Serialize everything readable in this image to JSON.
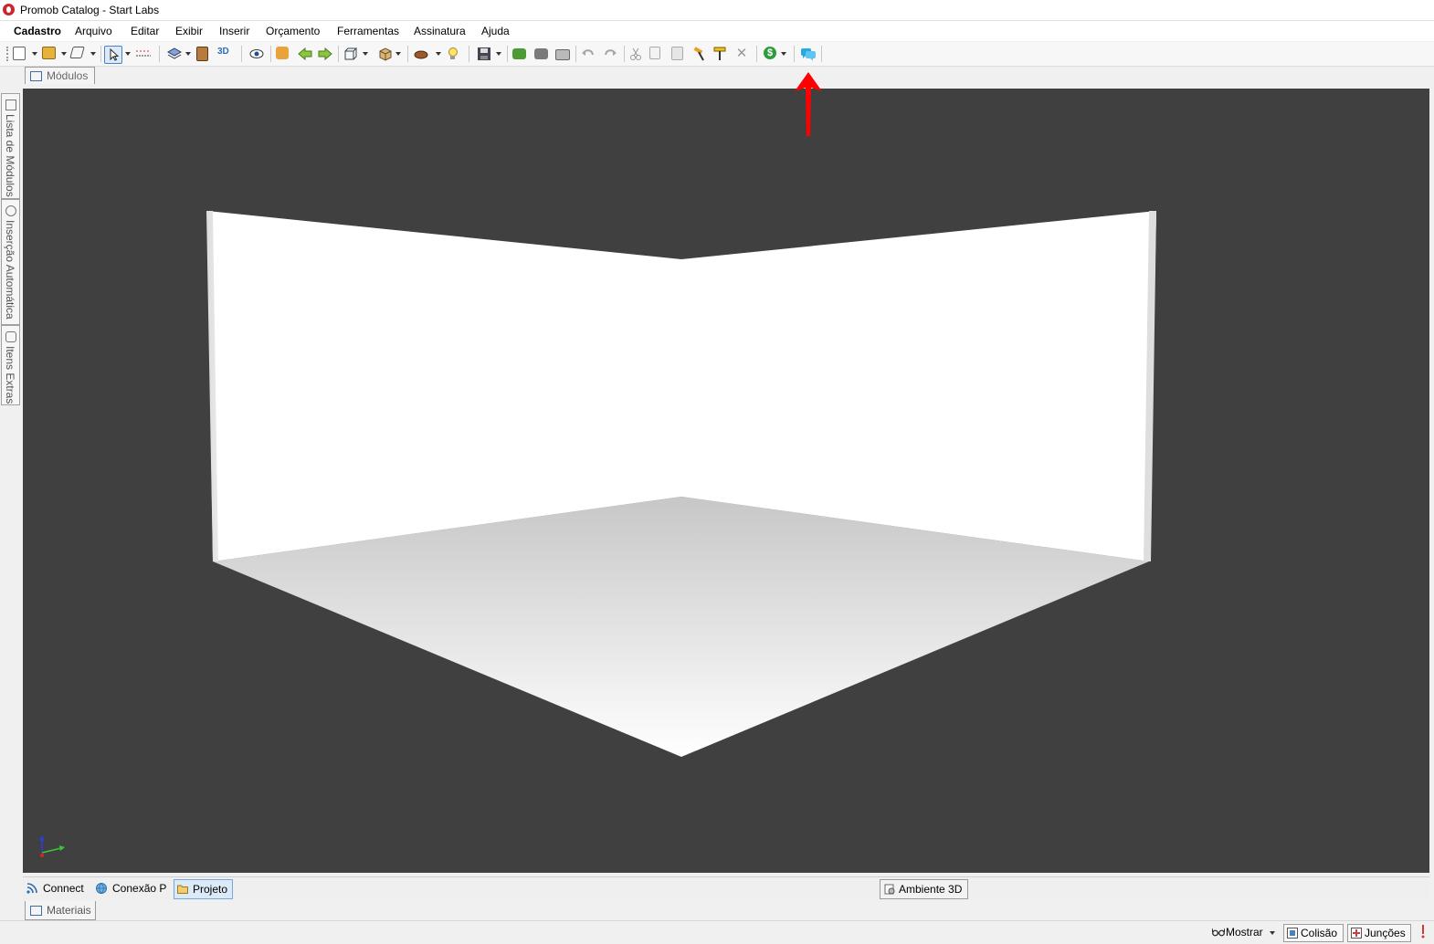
{
  "window": {
    "title": "Promob Catalog - Start Labs"
  },
  "menu": {
    "items": [
      "Cadastro",
      "Arquivo",
      "Editar",
      "Exibir",
      "Inserir",
      "Orçamento",
      "Ferramentas",
      "Assinatura",
      "Ajuda"
    ]
  },
  "toolbar": {
    "buttons": [
      "new-project-icon",
      "modules-icon",
      "shape-icon",
      "select-pointer-icon",
      "measure-icon",
      "layers-icon",
      "door-icon",
      "3d-view-icon",
      "eye-icon",
      "rotate-view-icon",
      "arrow-left-icon",
      "arrow-right-icon",
      "cube-wireframe-icon",
      "box-icon",
      "render-icon",
      "light-bulb-icon",
      "save-icon",
      "export-icon",
      "import-icon",
      "print-icon",
      "undo-icon",
      "redo-icon",
      "cut-icon",
      "copy-icon",
      "paste-icon",
      "hammer-icon",
      "paint-roller-icon",
      "delete-icon",
      "budget-icon",
      "chat-icon"
    ],
    "chat_color": "#29a9e1"
  },
  "tabs": {
    "modulos": "Módulos"
  },
  "side_tabs": [
    "Lista de Módulos",
    "Inserção Automática",
    "Itens Extras"
  ],
  "bottom_tabs": {
    "connect": "Connect",
    "conexao": "Conexão P",
    "projeto": "Projeto",
    "ambiente": "Ambiente 3D"
  },
  "materiais_tab": "Materiais",
  "status": {
    "mostrar": "Mostrar",
    "colisao": "Colisão",
    "juncoes": "Junções"
  },
  "colors": {
    "viewport": "#404040",
    "annotation_arrow": "#ff0000"
  }
}
